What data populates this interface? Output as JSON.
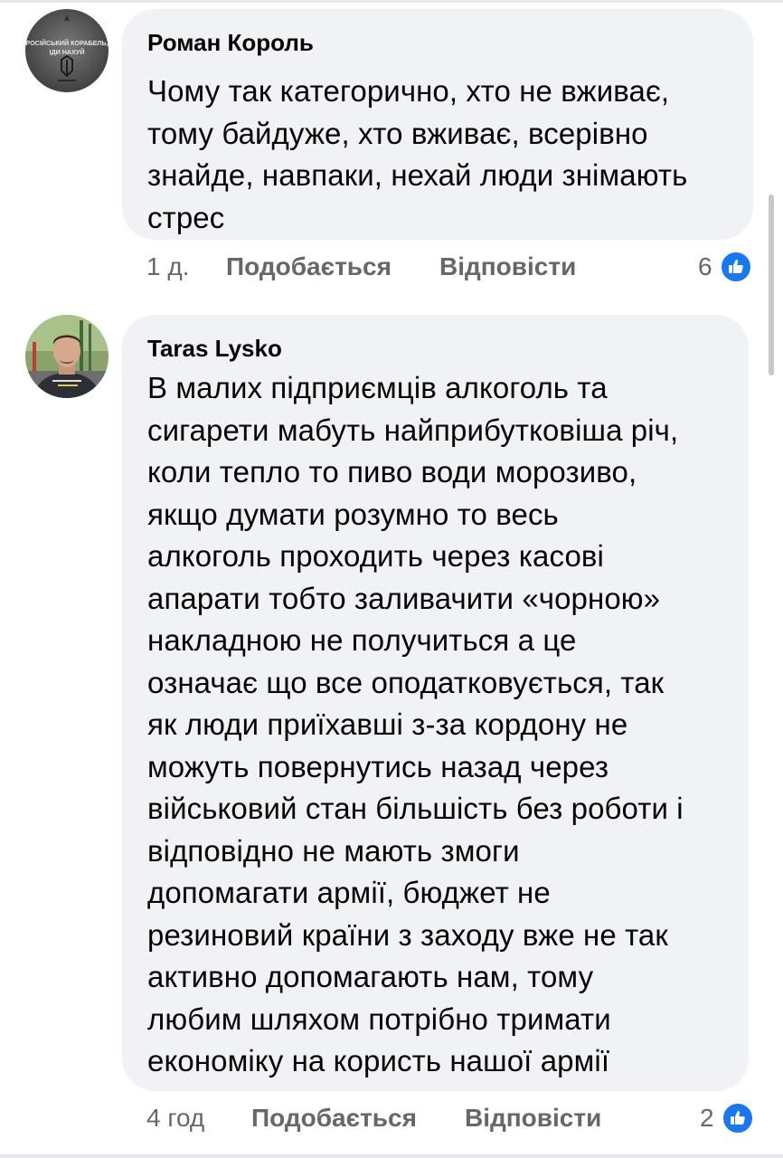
{
  "comments": [
    {
      "author": "Роман Король",
      "avatar": "avatar-image",
      "avatar_text": "РОСІЙСЬКИЙ КОРАБЕЛЬ, ІДИ НАХУЙ",
      "text": "Чому так категорично, хто не вживає,\nтому байдуже, хто вживає, всерівно\nзнайде, навпаки, нехай люди знімають\nстрес",
      "time": "1 д.",
      "like_label": "Подобається",
      "reply_label": "Відповісти",
      "reactions": "6",
      "reaction_icon": "thumbs-up-icon"
    },
    {
      "author": "Taras Lysko",
      "avatar": "avatar-photo",
      "text": "В малих підприємців алкоголь та\nсигарети мабуть найприбутковіша річ,\nколи тепло то пиво води морозиво,\nякщо думати розумно то весь\nалкоголь проходить через касові\nапарати тобто заливачити «чорною»\nнакладною не получиться а це\nозначає що все оподатковується, так\nяк люди приїхавші з-за кордону не\nможуть повернутись назад через\nвійськовий стан більшість без роботи і\nвідповідно не мають змоги\nдопомагати армії, бюджет не\nрезиновий країни з заходу вже не так\nактивно допомагають нам, тому\nлюбим шляхом потрібно тримати\nекономіку на користь нашої армії",
      "time": "4 год",
      "like_label": "Подобається",
      "reply_label": "Відповісти",
      "reactions": "2",
      "reaction_icon": "thumbs-up-icon"
    }
  ],
  "colors": {
    "bubble": "#f0f2f5",
    "meta": "#65676b",
    "like_blue": "#1877f2"
  }
}
